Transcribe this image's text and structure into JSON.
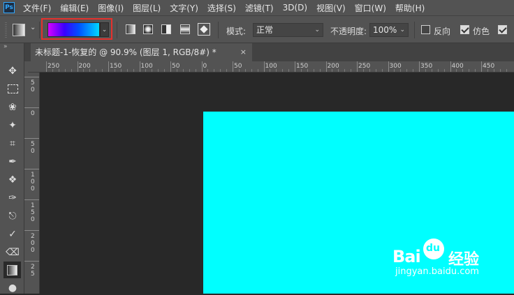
{
  "app_logo": "Ps",
  "menu": [
    "文件(F)",
    "编辑(E)",
    "图像(I)",
    "图层(L)",
    "文字(Y)",
    "选择(S)",
    "滤镜(T)",
    "3D(D)",
    "视图(V)",
    "窗口(W)",
    "帮助(H)"
  ],
  "options": {
    "mode_label": "模式:",
    "mode_value": "正常",
    "opacity_label": "不透明度:",
    "opacity_value": "100%",
    "reverse_label": "反向",
    "dither_label": "仿色",
    "reverse_checked": false,
    "dither_checked": true,
    "transparency_checked": true,
    "gradient_colors": [
      "#d600ff",
      "#3a00ff",
      "#0050ff",
      "#00d8ff"
    ]
  },
  "document": {
    "tab_title": "未标题-1-恢复的 @ 90.9% (图层 1, RGB/8#) *",
    "close": "×",
    "canvas_color": "#00ffff"
  },
  "ruler_top_labels": [
    "250",
    "200",
    "150",
    "100",
    "50",
    "0",
    "50",
    "100",
    "150",
    "200",
    "250",
    "300",
    "350",
    "400",
    "450"
  ],
  "ruler_left_labels": [
    "5\n0",
    "0",
    "5\n0",
    "1\n0\n0",
    "1\n5\n0",
    "2\n0\n0",
    "2\n5"
  ],
  "watermark": {
    "brand_left": "Bai",
    "brand_du": "du",
    "brand_right": "经验",
    "url": "jingyan.baidu.com"
  }
}
